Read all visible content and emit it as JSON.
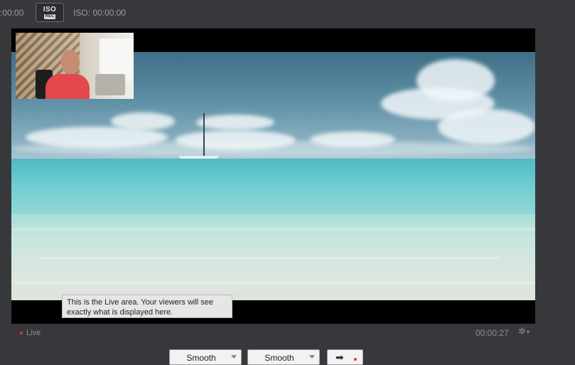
{
  "topbar": {
    "timecode": ":00:00",
    "iso_button": {
      "label": "ISO",
      "badge": "REC"
    },
    "iso_status": "ISO:  00:00:00"
  },
  "live_area": {
    "tooltip": "This is the Live area.  Your viewers will see exactly what is displayed here.",
    "status_label": "Live",
    "status_color": "#e0373b",
    "elapsed": "00:00:27"
  },
  "controls": {
    "transition_left": "Smooth",
    "transition_right": "Smooth",
    "go_icon": "right-arrow-icon"
  }
}
